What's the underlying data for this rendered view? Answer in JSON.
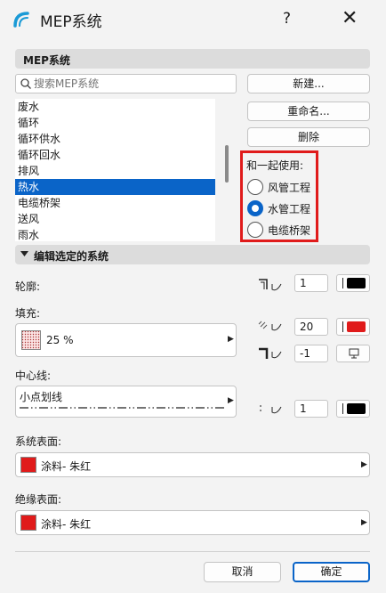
{
  "window": {
    "title": "MEP系统",
    "help": "?",
    "close": "✕"
  },
  "mep_section": {
    "label": "MEP系统"
  },
  "search": {
    "placeholder": "搜索MEP系统"
  },
  "buttons": {
    "new": "新建...",
    "rename": "重命名...",
    "delete": "删除",
    "cancel": "取消",
    "ok": "确定"
  },
  "systems": [
    "废水",
    "循环",
    "循环供水",
    "循环回水",
    "排风",
    "热水",
    "电缆桥架",
    "送风",
    "雨水"
  ],
  "selected_system": "热水",
  "use_with": {
    "label": "和一起使用:",
    "options": [
      "风管工程",
      "水管工程",
      "电缆桥架"
    ],
    "selected": "水管工程"
  },
  "edit_section": {
    "label": "编辑选定的系统"
  },
  "outline": {
    "label": "轮廓:",
    "pen": "1",
    "pen_color": "#000000"
  },
  "fill": {
    "label": "填充:",
    "value": "25 %",
    "pen": "20",
    "pen_color": "#e01b1b",
    "bg_pen": "-1"
  },
  "centerline": {
    "label": "中心线:",
    "value": "小点划线",
    "pen": "1",
    "pen_color": "#000000"
  },
  "system_surface": {
    "label": "系统表面:",
    "value": "涂料- 朱红",
    "color": "#e01b1b"
  },
  "insulation_surface": {
    "label": "绝缘表面:",
    "value": "涂料- 朱红",
    "color": "#e01b1b"
  }
}
